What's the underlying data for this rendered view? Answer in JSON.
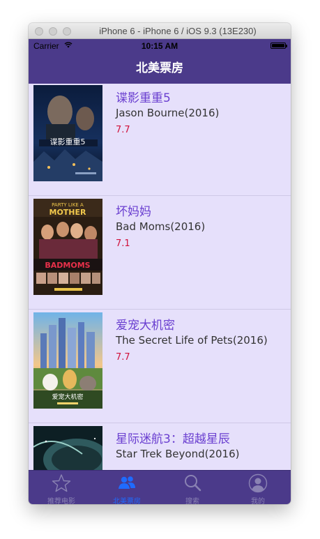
{
  "window": {
    "title": "iPhone 6 - iPhone 6 / iOS 9.3 (13E230)"
  },
  "status_bar": {
    "carrier": "Carrier",
    "wifi_icon": "wifi-icon",
    "time": "10:15 AM",
    "battery_icon": "battery-full-icon"
  },
  "nav": {
    "title": "北美票房"
  },
  "movies": [
    {
      "title": "谍影重重5",
      "subtitle": "Jason Bourne(2016)",
      "rating": "7.7"
    },
    {
      "title": "坏妈妈",
      "subtitle": "Bad Moms(2016)",
      "rating": "7.1"
    },
    {
      "title": "爱宠大机密",
      "subtitle": "The Secret Life of Pets(2016)",
      "rating": "7.7"
    },
    {
      "title": "星际迷航3：超越星辰",
      "subtitle": "Star Trek Beyond(2016)",
      "rating": ""
    }
  ],
  "tabs": [
    {
      "label": "推荐电影",
      "icon": "star-icon",
      "active": false
    },
    {
      "label": "北美票房",
      "icon": "people-icon",
      "active": true
    },
    {
      "label": "搜索",
      "icon": "search-icon",
      "active": false
    },
    {
      "label": "我的",
      "icon": "user-icon",
      "active": false
    }
  ],
  "colors": {
    "bar_background": "#4b3a8a",
    "list_background": "#e6e0fb",
    "title_text": "#6a3fd0",
    "rating_text": "#d0103a",
    "active_tab": "#1f6bff",
    "inactive_tab": "#8a82b3"
  }
}
